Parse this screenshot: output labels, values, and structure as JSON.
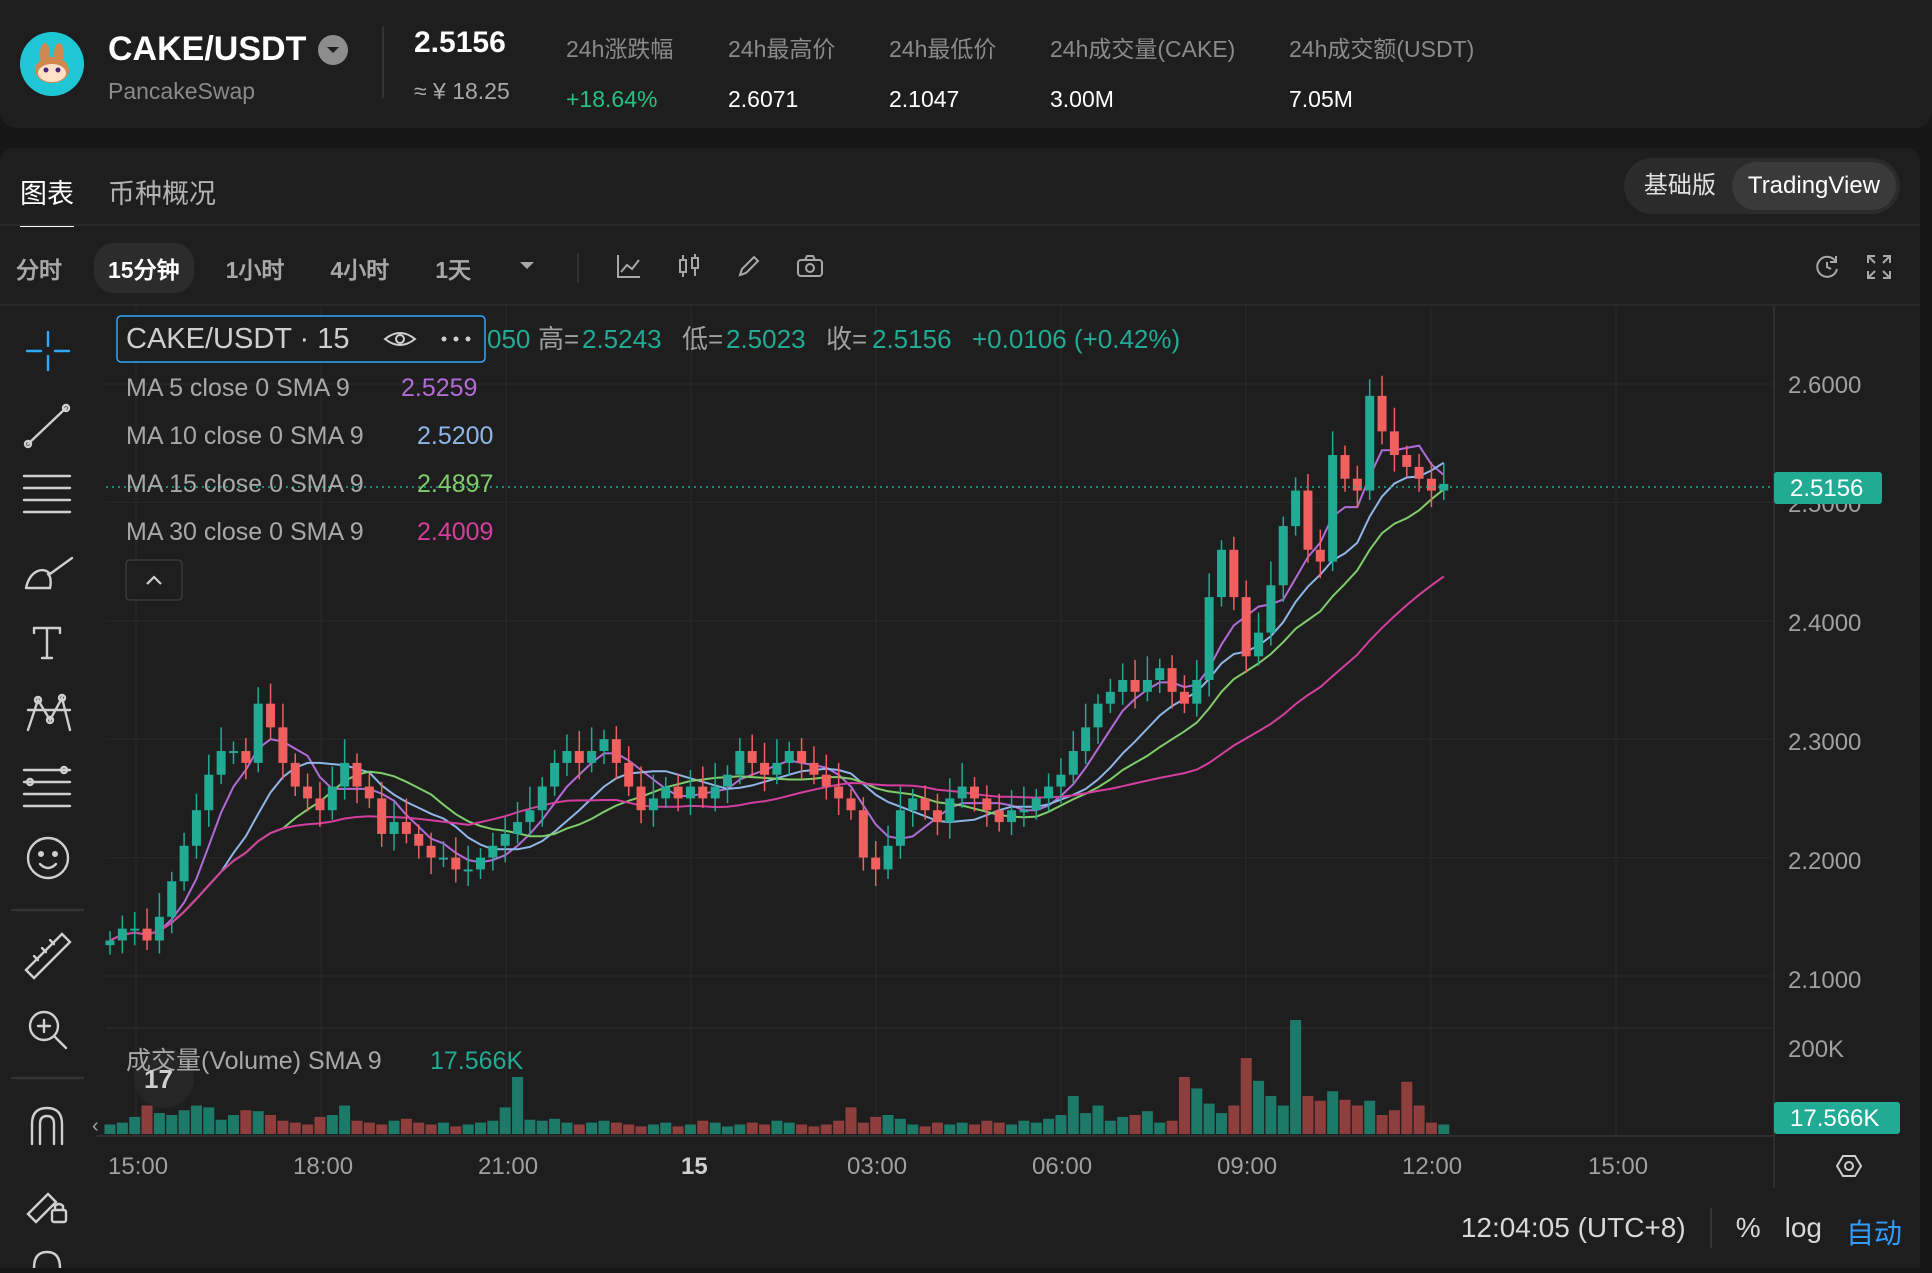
{
  "header": {
    "pair": "CAKE/USDT",
    "exchange": "PancakeSwap",
    "price": "2.5156",
    "price_cny": "≈ ¥ 18.25",
    "stats": [
      {
        "label": "24h涨跌幅",
        "value": "+18.64%",
        "green": true
      },
      {
        "label": "24h最高价",
        "value": "2.6071"
      },
      {
        "label": "24h最低价",
        "value": "2.1047"
      },
      {
        "label": "24h成交量(CAKE)",
        "value": "3.00M"
      },
      {
        "label": "24h成交额(USDT)",
        "value": "7.05M"
      }
    ]
  },
  "tabs": {
    "chart": "图表",
    "overview": "币种概况"
  },
  "modes": {
    "basic": "基础版",
    "tradingview": "TradingView"
  },
  "timeframes": [
    "分时",
    "15分钟",
    "1小时",
    "4小时",
    "1天"
  ],
  "active_timeframe": "15分钟",
  "legend": {
    "symbol": "CAKE/USDT · 15",
    "ohlc_open_fragment": "050",
    "high_label": "高=",
    "high": "2.5243",
    "low_label": "低=",
    "low": "2.5023",
    "close_label": "收=",
    "close": "2.5156",
    "change": "+0.0106 (+0.42%)",
    "ma": [
      {
        "label": "MA 5 close 0 SMA 9",
        "value": "2.5259",
        "color": "#b36bd8"
      },
      {
        "label": "MA 10 close 0 SMA 9",
        "value": "2.5200",
        "color": "#8fb6e8"
      },
      {
        "label": "MA 15 close 0 SMA 9",
        "value": "2.4897",
        "color": "#7fcc6a"
      },
      {
        "label": "MA 30 close 0 SMA 9",
        "value": "2.4009",
        "color": "#d43e9e"
      }
    ],
    "volume_label": "成交量(Volume) SMA 9",
    "volume_value": "17.566K"
  },
  "price_axis": [
    "2.6000",
    "2.5000",
    "2.4000",
    "2.3000",
    "2.2000",
    "2.1000"
  ],
  "current_price_tag": "2.5156",
  "volume_axis": [
    "200K"
  ],
  "volume_tag": "17.566K",
  "time_axis": [
    "15:00",
    "18:00",
    "21:00",
    "15",
    "03:00",
    "06:00",
    "09:00",
    "12:00",
    "15:00"
  ],
  "clock": "12:04:05 (UTC+8)",
  "scale_options": {
    "percent": "%",
    "log": "log",
    "auto": "自动"
  },
  "colors": {
    "up": "#22ab94",
    "down": "#f15f5f",
    "bg": "#1e1e1e"
  },
  "chart_data": {
    "type": "candlestick",
    "interval": "15m",
    "y_range": [
      2.05,
      2.66
    ],
    "last_close": 2.5156,
    "closes": [
      2.13,
      2.14,
      2.14,
      2.13,
      2.15,
      2.18,
      2.21,
      2.24,
      2.27,
      2.29,
      2.29,
      2.28,
      2.33,
      2.31,
      2.28,
      2.26,
      2.25,
      2.24,
      2.26,
      2.28,
      2.26,
      2.25,
      2.22,
      2.23,
      2.22,
      2.21,
      2.2,
      2.2,
      2.19,
      2.19,
      2.2,
      2.21,
      2.22,
      2.23,
      2.24,
      2.26,
      2.28,
      2.29,
      2.28,
      2.29,
      2.3,
      2.28,
      2.26,
      2.24,
      2.25,
      2.26,
      2.25,
      2.26,
      2.25,
      2.26,
      2.27,
      2.29,
      2.28,
      2.27,
      2.28,
      2.29,
      2.28,
      2.27,
      2.26,
      2.25,
      2.24,
      2.2,
      2.19,
      2.21,
      2.24,
      2.25,
      2.24,
      2.23,
      2.25,
      2.26,
      2.25,
      2.24,
      2.23,
      2.24,
      2.24,
      2.25,
      2.26,
      2.27,
      2.29,
      2.31,
      2.33,
      2.34,
      2.35,
      2.34,
      2.35,
      2.36,
      2.34,
      2.33,
      2.35,
      2.42,
      2.46,
      2.42,
      2.37,
      2.39,
      2.43,
      2.48,
      2.51,
      2.46,
      2.45,
      2.54,
      2.52,
      2.51,
      2.59,
      2.56,
      2.54,
      2.53,
      2.52,
      2.51,
      2.5156
    ],
    "volumes_k": [
      10,
      12,
      18,
      30,
      22,
      20,
      25,
      30,
      28,
      15,
      20,
      25,
      24,
      20,
      14,
      12,
      10,
      18,
      20,
      30,
      14,
      12,
      10,
      14,
      16,
      12,
      10,
      12,
      8,
      10,
      12,
      14,
      28,
      60,
      15,
      14,
      16,
      12,
      10,
      12,
      14,
      12,
      10,
      8,
      10,
      12,
      8,
      10,
      14,
      12,
      8,
      10,
      12,
      10,
      14,
      12,
      10,
      8,
      10,
      14,
      28,
      12,
      18,
      20,
      16,
      10,
      8,
      12,
      10,
      12,
      10,
      14,
      12,
      10,
      14,
      12,
      16,
      20,
      40,
      22,
      30,
      14,
      18,
      20,
      24,
      12,
      14,
      60,
      48,
      32,
      22,
      30,
      80,
      56,
      40,
      30,
      120,
      40,
      35,
      45,
      36,
      30,
      35,
      20,
      25,
      55,
      30,
      12,
      10
    ]
  }
}
